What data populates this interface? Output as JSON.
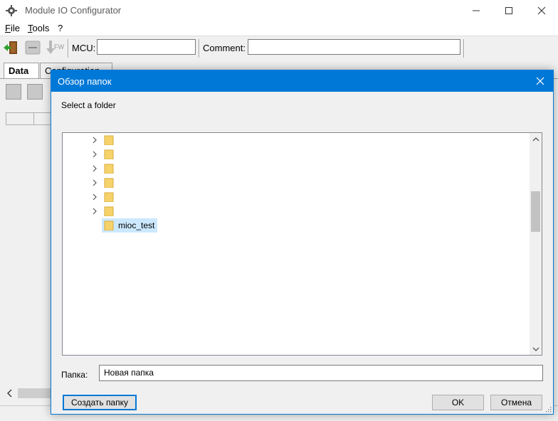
{
  "window": {
    "title": "Module IO Configurator",
    "controls": [
      "minimize-icon",
      "maximize-icon",
      "close-icon"
    ]
  },
  "menu": {
    "items": [
      {
        "label_underlined": "F",
        "label_rest": "ile"
      },
      {
        "label_underlined": "T",
        "label_rest": "ools"
      },
      {
        "label_underlined": "",
        "label_rest": "?"
      }
    ]
  },
  "toolbar": {
    "buttons": [
      "exit-icon",
      "disconnect-icon",
      "firmware-download-icon"
    ],
    "fw_label": "FW",
    "mcu_label": "MCU:",
    "mcu_value": "",
    "comment_label": "Comment:",
    "comment_value": ""
  },
  "tabs": [
    {
      "label": "Data",
      "active": true
    },
    {
      "label": "Configuration",
      "active": false
    }
  ],
  "dialog": {
    "title": "Обзор папок",
    "description": "Select a folder",
    "tree_items": [
      {
        "label": "",
        "expandable": true
      },
      {
        "label": "",
        "expandable": true
      },
      {
        "label": "",
        "expandable": true
      },
      {
        "label": "",
        "expandable": true
      },
      {
        "label": "",
        "expandable": true
      },
      {
        "label": "",
        "expandable": true
      },
      {
        "label": "mioc_test",
        "expandable": false,
        "selected": true
      }
    ],
    "folder_label": "Папка:",
    "folder_value": "Новая папка",
    "create_folder_button": "Создать папку",
    "ok_button": "OK",
    "cancel_button": "Отмена"
  },
  "colors": {
    "accent": "#0078d7",
    "selection": "#cce8ff",
    "folder": "#f6d26b"
  }
}
